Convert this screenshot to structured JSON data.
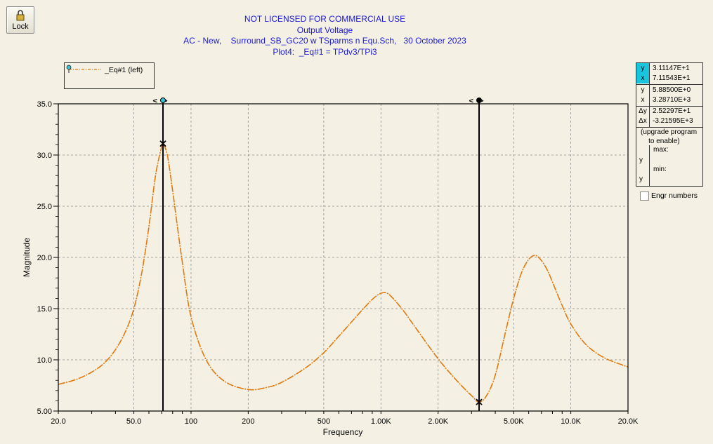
{
  "toolbar": {
    "lock_label": "Lock"
  },
  "header": {
    "line1": "NOT LICENSED FOR COMMERCIAL USE",
    "line2": "Output Voltage",
    "line3": "AC - New,    Surround_SB_GC20 w TSparms n Equ.Sch,   30 October 2023",
    "line4": "Plot4:  _Eq#1 = TPdv3/TPi3"
  },
  "legend": {
    "entry": "_Eq#1 (left)"
  },
  "readout": {
    "c1_y_key": "y",
    "c1_y": "3.11147E+1",
    "c1_x_key": "x",
    "c1_x": "7.11543E+1",
    "c2_y_key": "y",
    "c2_y": "5.88500E+0",
    "c2_x_key": "x",
    "c2_x": "3.28710E+3",
    "dy_key": "Δy",
    "dy": "2.52297E+1",
    "dx_key": "Δx",
    "dx": "-3.21595E+3",
    "upgrade": "(upgrade program\n    to enable)",
    "max_key": "y",
    "max_label": "max:",
    "min_key": "y",
    "min_label": "min:"
  },
  "engr": {
    "label": "Engr numbers",
    "checked": false
  },
  "colors": {
    "series": "#e07a10",
    "title": "#1b1bd8",
    "cursor1_marker": "#3cc0d8",
    "readout_highlight": "#19c5dc"
  },
  "cursor_glyph": "<>",
  "chart_data": {
    "type": "line",
    "x_scale": "log",
    "xlim": [
      20,
      20000
    ],
    "ylim": [
      5,
      35
    ],
    "xlabel": "Frequency",
    "ylabel": "Magnitude",
    "x_ticks": [
      20,
      50,
      100,
      200,
      500,
      1000,
      2000,
      5000,
      10000,
      20000
    ],
    "x_tick_labels": [
      "20.0",
      "50.0",
      "100",
      "200",
      "500",
      "1.00K",
      "2.00K",
      "5.00K",
      "10.0K",
      "20.0K"
    ],
    "y_ticks": [
      5,
      10,
      15,
      20,
      25,
      30,
      35
    ],
    "y_tick_labels": [
      "5.00",
      "10.0",
      "15.0",
      "20.0",
      "25.0",
      "30.0",
      "35.0"
    ],
    "grid": true,
    "series": [
      {
        "name": "_Eq#1 (left)",
        "x": [
          20,
          25,
          30,
          35,
          40,
          45,
          50,
          55,
          60,
          65,
          70,
          71.15,
          75,
          80,
          90,
          100,
          120,
          150,
          200,
          250,
          300,
          400,
          500,
          600,
          700,
          800,
          900,
          1000,
          1100,
          1300,
          1500,
          2000,
          2500,
          3000,
          3287,
          3600,
          4000,
          4500,
          5000,
          5500,
          6000,
          6500,
          7000,
          7500,
          8000,
          9000,
          10000,
          12000,
          15000,
          20000
        ],
        "y": [
          7.6,
          8.1,
          8.8,
          9.7,
          11.0,
          12.7,
          15.0,
          18.5,
          23.0,
          28.0,
          30.8,
          31.11,
          30.0,
          26.5,
          19.5,
          14.2,
          10.0,
          7.9,
          7.1,
          7.3,
          7.8,
          9.2,
          10.7,
          12.3,
          13.7,
          14.9,
          15.9,
          16.5,
          16.4,
          14.9,
          13.3,
          10.1,
          8.0,
          6.5,
          5.885,
          6.5,
          8.5,
          12.5,
          16.0,
          18.5,
          19.8,
          20.2,
          19.7,
          18.8,
          17.6,
          15.3,
          13.5,
          11.5,
          10.2,
          9.3
        ]
      }
    ],
    "cursors": [
      {
        "x": 71.1543,
        "y": 31.1147,
        "marker": "open"
      },
      {
        "x": 3287.1,
        "y": 5.885,
        "marker": "filled"
      }
    ]
  }
}
